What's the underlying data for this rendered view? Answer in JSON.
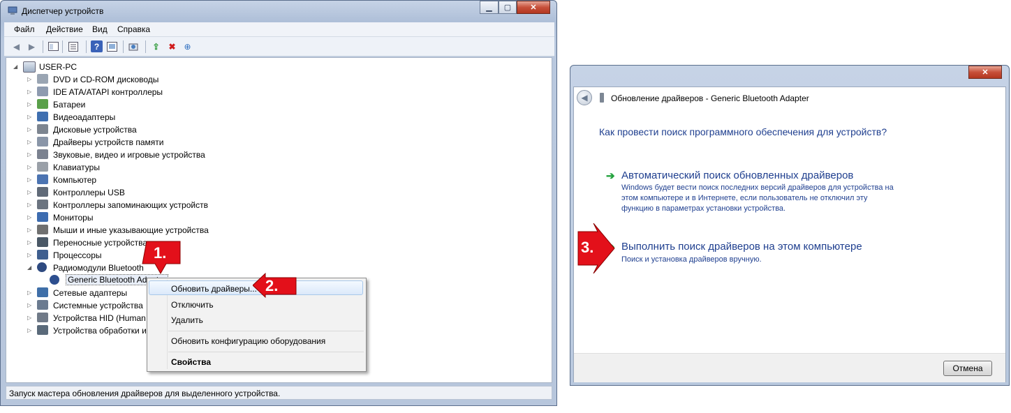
{
  "device_manager": {
    "title": "Диспетчер устройств",
    "menu": [
      "Файл",
      "Действие",
      "Вид",
      "Справка"
    ],
    "toolbar_icons": [
      "back-icon",
      "forward-icon",
      "up-level-icon",
      "properties-icon",
      "help-icon",
      "show-hidden-icon",
      "scan-hardware-icon",
      "update-driver-icon",
      "uninstall-icon",
      "disable-icon"
    ],
    "root": "USER-PC",
    "categories": [
      "DVD и CD-ROM дисководы",
      "IDE ATA/ATAPI контроллеры",
      "Батареи",
      "Видеоадаптеры",
      "Дисковые устройства",
      "Драйверы устройств памяти",
      "Звуковые, видео и игровые устройства",
      "Клавиатуры",
      "Компьютер",
      "Контроллеры USB",
      "Контроллеры запоминающих устройств",
      "Мониторы",
      "Мыши и иные указывающие устройства",
      "Переносные устройства",
      "Процессоры",
      "Радиомодули Bluetooth",
      "Generic Bluetooth Adapter",
      "Сетевые адаптеры",
      "Системные устройства",
      "Устройства HID (Human I",
      "Устройства обработки из"
    ],
    "status": "Запуск мастера обновления драйверов для выделенного устройства."
  },
  "context_menu": {
    "items": [
      "Обновить драйверы...",
      "Отключить",
      "Удалить",
      "Обновить конфигурацию оборудования",
      "Свойства"
    ]
  },
  "steps": [
    "1.",
    "2.",
    "3."
  ],
  "update_dialog": {
    "title": "Обновление драйверов - Generic Bluetooth Adapter",
    "question": "Как провести поиск программного обеспечения для устройств?",
    "option1_title": "Автоматический поиск обновленных драйверов",
    "option1_desc1": "Windows будет вести поиск последних версий драйверов для устройства на",
    "option1_desc2": "этом компьютере и в Интернете, если пользователь не отключил эту",
    "option1_desc3": "функцию в параметрах установки устройства.",
    "option2_title": "Выполнить поиск драйверов на этом компьютере",
    "option2_desc": "Поиск и установка драйверов вручную.",
    "cancel": "Отмена"
  },
  "colors": {
    "link_blue": "#1f3f8f",
    "step_red": "#e3101a",
    "green_arrow": "#23a23d"
  }
}
